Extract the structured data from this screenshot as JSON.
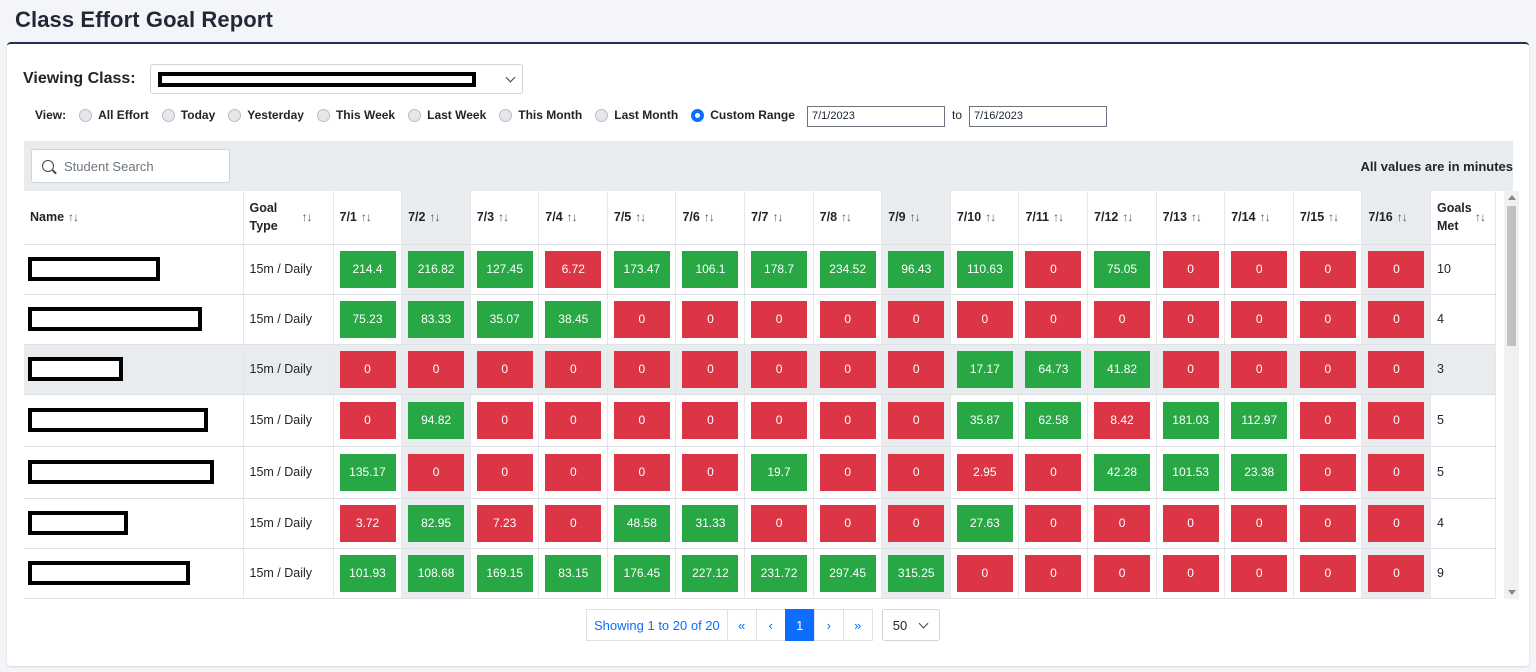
{
  "title": "Class Effort Goal Report",
  "class_selector": {
    "label": "Viewing Class:",
    "value": ""
  },
  "view": {
    "label": "View:",
    "options": [
      "All Effort",
      "Today",
      "Yesterday",
      "This Week",
      "Last Week",
      "This Month",
      "Last Month",
      "Custom Range"
    ],
    "selected": "Custom Range",
    "from": "7/1/2023",
    "to_label": "to",
    "to": "7/16/2023"
  },
  "search": {
    "placeholder": "Student Search"
  },
  "units_note": "All values are in minutes",
  "table": {
    "headers": {
      "name": "Name",
      "goal_type": "Goal Type",
      "dates": [
        "7/1",
        "7/2",
        "7/3",
        "7/4",
        "7/5",
        "7/6",
        "7/7",
        "7/8",
        "7/9",
        "7/10",
        "7/11",
        "7/12",
        "7/13",
        "7/14",
        "7/15",
        "7/16"
      ],
      "goals_met": "Goals Met"
    },
    "weekend_columns": [
      "7/2",
      "7/9",
      "7/16"
    ],
    "rows": [
      {
        "goal_type": "15m / Daily",
        "values": [
          "214.4",
          "216.82",
          "127.45",
          "6.72",
          "173.47",
          "106.1",
          "178.7",
          "234.52",
          "96.43",
          "110.63",
          "0",
          "75.05",
          "0",
          "0",
          "0",
          "0"
        ],
        "met": [
          1,
          1,
          1,
          0,
          1,
          1,
          1,
          1,
          1,
          1,
          0,
          1,
          0,
          0,
          0,
          0
        ],
        "goals_met": "10"
      },
      {
        "goal_type": "15m / Daily",
        "values": [
          "75.23",
          "83.33",
          "35.07",
          "38.45",
          "0",
          "0",
          "0",
          "0",
          "0",
          "0",
          "0",
          "0",
          "0",
          "0",
          "0",
          "0"
        ],
        "met": [
          1,
          1,
          1,
          1,
          0,
          0,
          0,
          0,
          0,
          0,
          0,
          0,
          0,
          0,
          0,
          0
        ],
        "goals_met": "4"
      },
      {
        "goal_type": "15m / Daily",
        "values": [
          "0",
          "0",
          "0",
          "0",
          "0",
          "0",
          "0",
          "0",
          "0",
          "17.17",
          "64.73",
          "41.82",
          "0",
          "0",
          "0",
          "0"
        ],
        "met": [
          0,
          0,
          0,
          0,
          0,
          0,
          0,
          0,
          0,
          1,
          1,
          1,
          0,
          0,
          0,
          0
        ],
        "goals_met": "3"
      },
      {
        "goal_type": "15m / Daily",
        "values": [
          "0",
          "94.82",
          "0",
          "0",
          "0",
          "0",
          "0",
          "0",
          "0",
          "35.87",
          "62.58",
          "8.42",
          "181.03",
          "112.97",
          "0",
          "0"
        ],
        "met": [
          0,
          1,
          0,
          0,
          0,
          0,
          0,
          0,
          0,
          1,
          1,
          0,
          1,
          1,
          0,
          0
        ],
        "goals_met": "5"
      },
      {
        "goal_type": "15m / Daily",
        "values": [
          "135.17",
          "0",
          "0",
          "0",
          "0",
          "0",
          "19.7",
          "0",
          "0",
          "2.95",
          "0",
          "42.28",
          "101.53",
          "23.38",
          "0",
          "0"
        ],
        "met": [
          1,
          0,
          0,
          0,
          0,
          0,
          1,
          0,
          0,
          0,
          0,
          1,
          1,
          1,
          0,
          0
        ],
        "goals_met": "5"
      },
      {
        "goal_type": "15m / Daily",
        "values": [
          "3.72",
          "82.95",
          "7.23",
          "0",
          "48.58",
          "31.33",
          "0",
          "0",
          "0",
          "27.63",
          "0",
          "0",
          "0",
          "0",
          "0",
          "0"
        ],
        "met": [
          0,
          1,
          0,
          0,
          1,
          1,
          0,
          0,
          0,
          1,
          0,
          0,
          0,
          0,
          0,
          0
        ],
        "goals_met": "4"
      },
      {
        "goal_type": "15m / Daily",
        "values": [
          "101.93",
          "108.68",
          "169.15",
          "83.15",
          "176.45",
          "227.12",
          "231.72",
          "297.45",
          "315.25",
          "0",
          "0",
          "0",
          "0",
          "0",
          "0",
          "0"
        ],
        "met": [
          1,
          1,
          1,
          1,
          1,
          1,
          1,
          1,
          1,
          0,
          0,
          0,
          0,
          0,
          0,
          0
        ],
        "goals_met": "9"
      }
    ],
    "highlighted_row": 2
  },
  "pagination": {
    "info": "Showing 1 to 20 of 20",
    "first": "«",
    "prev": "‹",
    "current": "1",
    "next": "›",
    "last": "»",
    "page_size": "50"
  },
  "colors": {
    "met": "#28a745",
    "miss": "#dc3545",
    "accent": "#0d6efd",
    "header_border": "#1e3552"
  }
}
